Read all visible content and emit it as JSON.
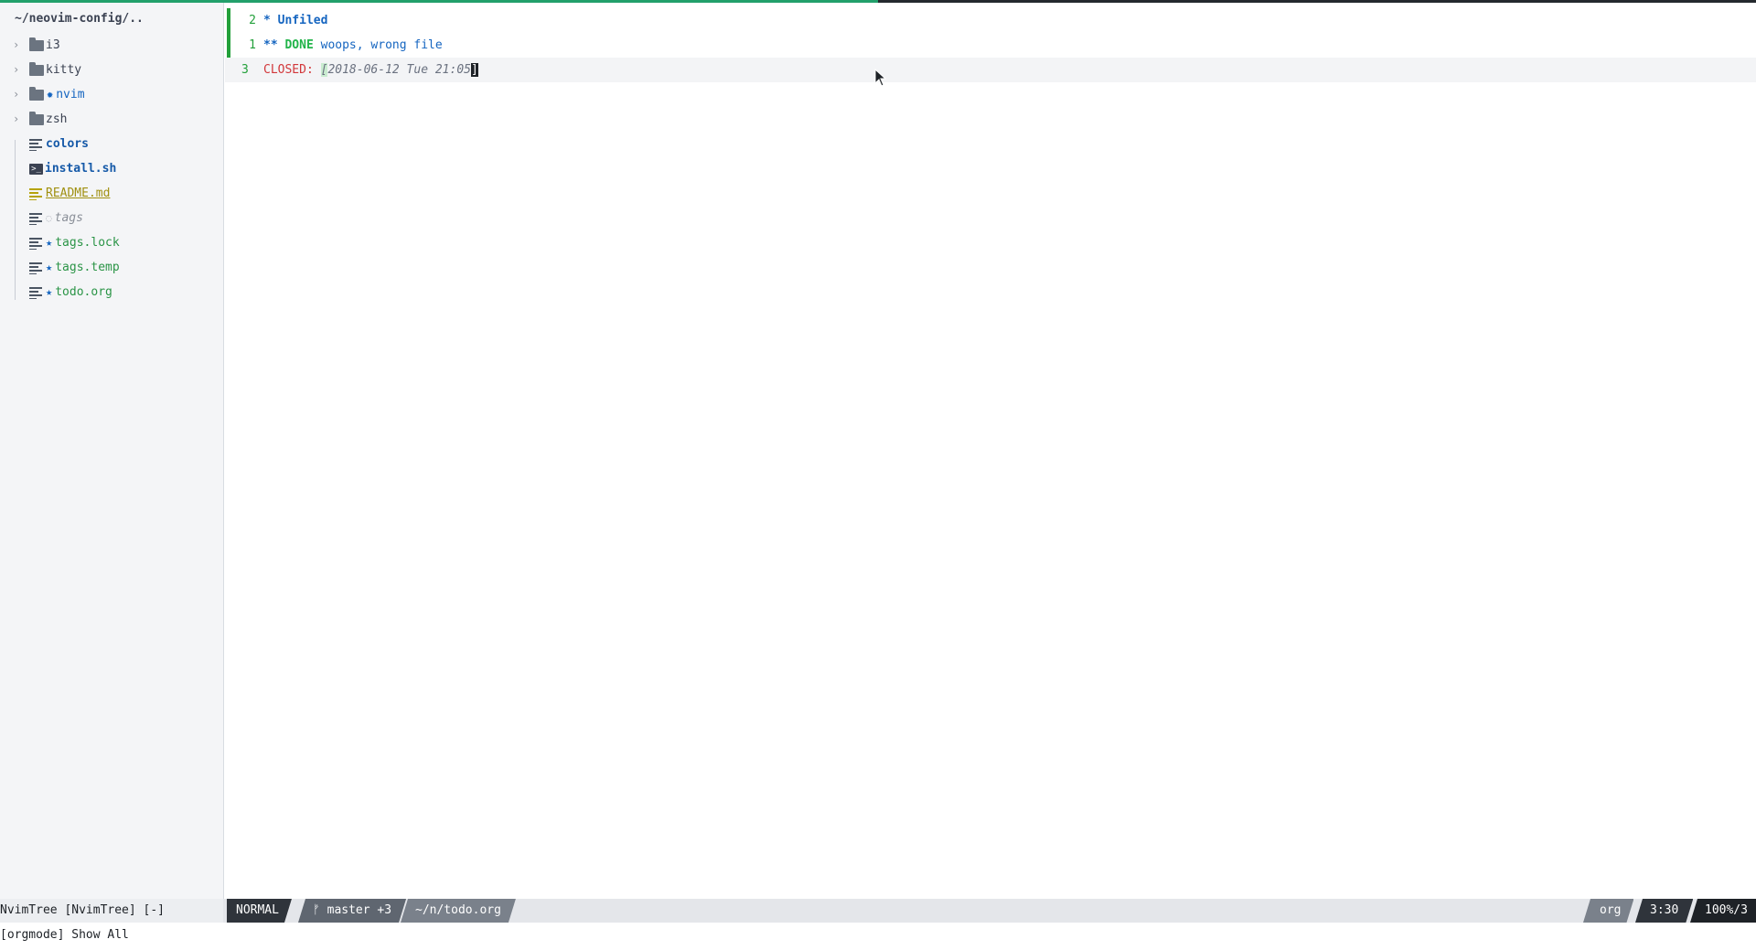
{
  "tree": {
    "root": "~/neovim-config/..",
    "items": [
      {
        "name": "i3",
        "kind": "folder",
        "icon": "folder-icon",
        "style": "dir"
      },
      {
        "name": "kitty",
        "kind": "folder",
        "icon": "folder-icon",
        "style": "dir"
      },
      {
        "name": "nvim",
        "kind": "folder",
        "icon": "folder-icon",
        "badge": "gear-icon",
        "style": "blue"
      },
      {
        "name": "zsh",
        "kind": "folder",
        "icon": "folder-icon",
        "style": "dir"
      },
      {
        "name": "colors",
        "kind": "file",
        "icon": "file-lines-icon",
        "style": "bold"
      },
      {
        "name": "install.sh",
        "kind": "file",
        "icon": "terminal-icon",
        "style": "bold"
      },
      {
        "name": "README.md",
        "kind": "file",
        "icon": "file-lines-icon",
        "style": "yellow"
      },
      {
        "name": "tags",
        "kind": "file",
        "icon": "file-lines-icon",
        "badge": "ignored-icon",
        "style": "italic"
      },
      {
        "name": "tags.lock",
        "kind": "file",
        "icon": "file-lines-icon",
        "badge": "star-icon",
        "style": "green"
      },
      {
        "name": "tags.temp",
        "kind": "file",
        "icon": "file-lines-icon",
        "badge": "star-icon",
        "style": "green"
      },
      {
        "name": "todo.org",
        "kind": "file",
        "icon": "file-lines-icon",
        "badge": "star-icon",
        "style": "green"
      }
    ]
  },
  "editor": {
    "lines": [
      {
        "num": "2",
        "heading": "* Unfiled"
      },
      {
        "num": "1",
        "stars": "**",
        "keyword": "DONE",
        "title": "woops, wrong file"
      },
      {
        "num": "3",
        "label": "CLOSED:",
        "open_bracket": "[",
        "date": "2018-06-12 Tue 21:05",
        "close_bracket": "]"
      }
    ]
  },
  "statusline": {
    "tree_label": "NvimTree [NvimTree] [-]",
    "mode": "NORMAL",
    "branch_icon": "git-branch-icon",
    "branch": "ᚠ master +3",
    "file": "~/n/todo.org",
    "filetype": "org",
    "position": "3:30",
    "percent": "100%/3"
  },
  "cmdline": "[orgmode] Show All",
  "colors": {
    "accent_green": "#22a03a",
    "heading_blue": "#1565c0",
    "closed_red": "#d2373a",
    "done_green": "#22b44a"
  }
}
